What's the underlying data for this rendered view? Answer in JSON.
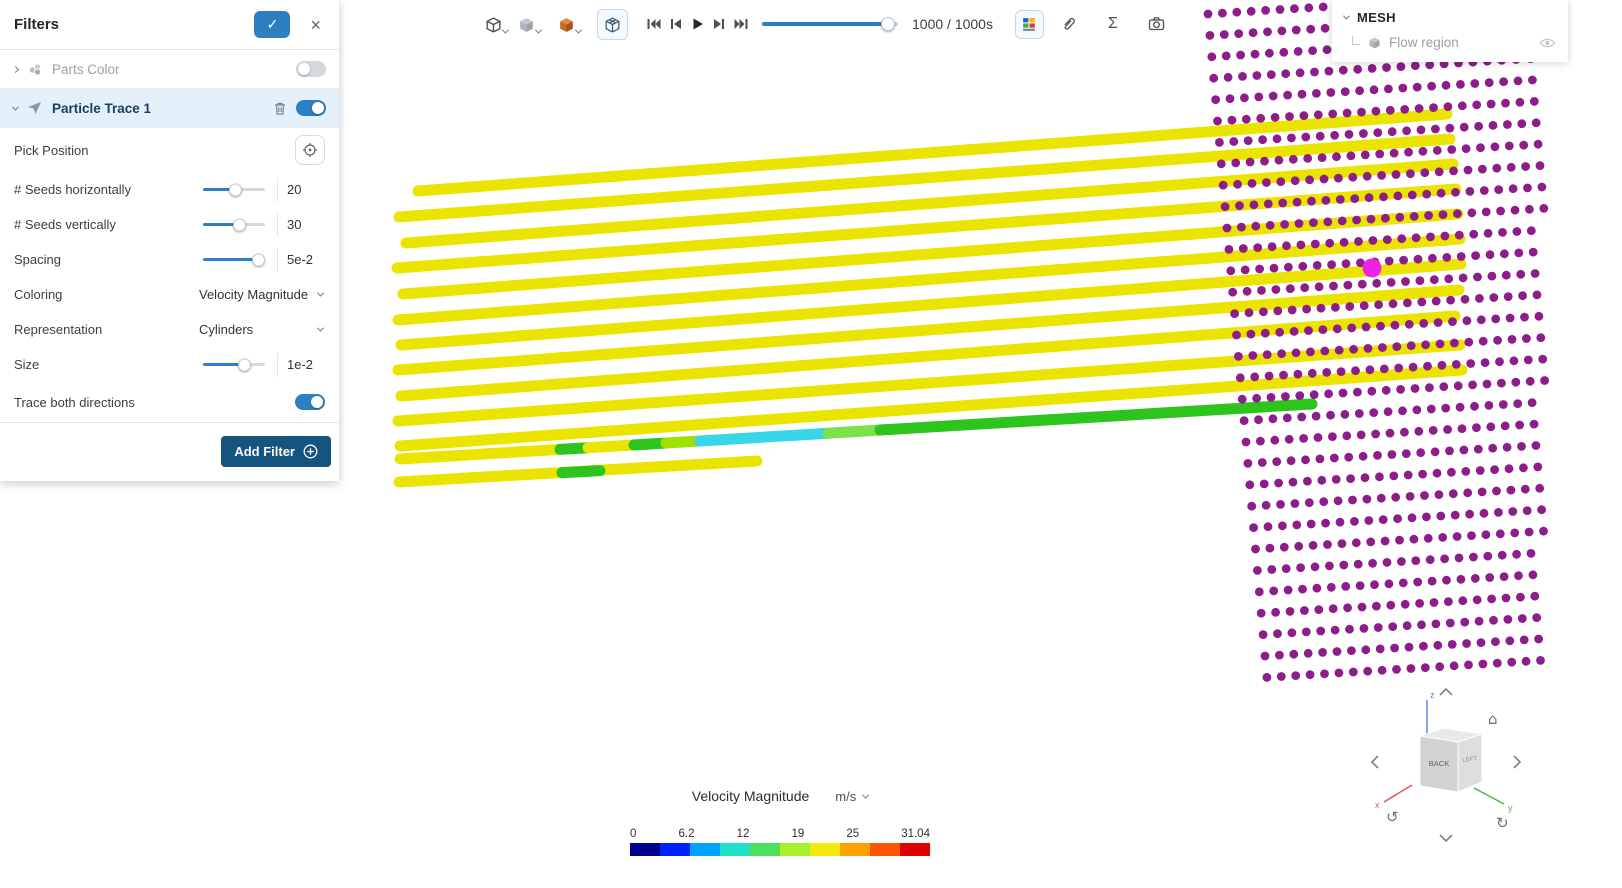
{
  "colors": {
    "accent": "#2e7fc1",
    "accent_dark": "#15547f",
    "active_row_bg": "#e4f0fa",
    "tube_yellow": "#ebe400",
    "dot_purple": "#8c1d8a",
    "pick_magenta": "#ee22e2"
  },
  "icons": {
    "check": "✓",
    "close": "×",
    "sigma": "Σ",
    "home": "⌂",
    "rotate_left": "↺",
    "rotate_right": "↻"
  },
  "filters_panel": {
    "title": "Filters",
    "parts_color": {
      "label": "Parts Color",
      "enabled": false
    },
    "particle_trace": {
      "label": "Particle Trace 1",
      "enabled": true
    },
    "properties": {
      "pick_position": {
        "label": "Pick Position"
      },
      "seeds_h": {
        "label": "# Seeds horizontally",
        "value": "20",
        "fill": 52
      },
      "seeds_v": {
        "label": "# Seeds vertically",
        "value": "30",
        "fill": 58
      },
      "spacing": {
        "label": "Spacing",
        "value": "5e-2",
        "fill": 89
      },
      "coloring": {
        "label": "Coloring",
        "value": "Velocity Magnitude"
      },
      "representation": {
        "label": "Representation",
        "value": "Cylinders"
      },
      "size": {
        "label": "Size",
        "value": "1e-2",
        "fill": 66
      },
      "trace_both": {
        "label": "Trace both directions",
        "enabled": true
      }
    },
    "add_filter_label": "Add Filter"
  },
  "toolbar": {
    "time_display": "1000 / 1000s",
    "timeline_fill": 93
  },
  "mesh_panel": {
    "title": "MESH",
    "items": [
      {
        "label": "Flow region"
      }
    ]
  },
  "legend": {
    "title": "Velocity Magnitude",
    "unit": "m/s",
    "ticks": [
      "0",
      "6.2",
      "12",
      "19",
      "25",
      "31.04"
    ],
    "colors": [
      "#00008f",
      "#0020ff",
      "#00a4ff",
      "#22e0c8",
      "#4de05a",
      "#a8ef2e",
      "#f2e80c",
      "#ffa000",
      "#ff5400",
      "#e00000"
    ]
  },
  "gizmo": {
    "front_face": "BACK",
    "side_face": "LEFT",
    "axes": {
      "x": "x",
      "y": "y",
      "z": "z"
    }
  }
}
